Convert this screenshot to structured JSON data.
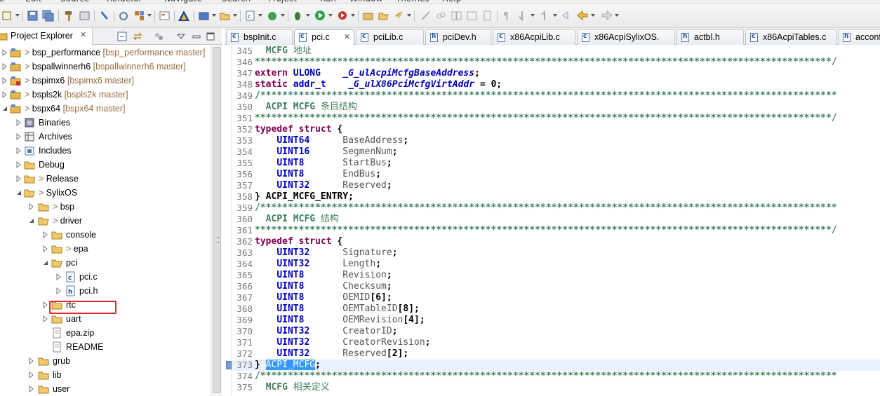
{
  "menu": {
    "items": [
      "File",
      "Edit",
      "Source",
      "Refactor",
      "Navigate",
      "Search",
      "Project",
      "Run",
      "Window",
      "Themes",
      "Help"
    ]
  },
  "explorer": {
    "title": "Project Explorer",
    "tree": [
      {
        "label": "bsp_performance",
        "repo": "[bsp_performance master]",
        "prefix": "> "
      },
      {
        "label": "bspallwinnerh6",
        "repo": "[bspallwinnerh6 master]",
        "prefix": "> "
      },
      {
        "label": "bspimx6",
        "repo": "[bspimx6 master]",
        "prefix": "> "
      },
      {
        "label": "bspls2k",
        "repo": "[bspls2k master]",
        "prefix": "> "
      },
      {
        "label": "bspx64",
        "repo": "[bspx64 master]",
        "prefix": "> "
      },
      {
        "label": "Binaries"
      },
      {
        "label": "Archives"
      },
      {
        "label": "Includes"
      },
      {
        "label": "Debug"
      },
      {
        "label": "Release",
        "prefix": "> "
      },
      {
        "label": "SylixOS",
        "prefix": "> "
      },
      {
        "label": "bsp",
        "prefix": "> "
      },
      {
        "label": "driver",
        "prefix": "> "
      },
      {
        "label": "console"
      },
      {
        "label": "epa",
        "prefix": "> "
      },
      {
        "label": "pci"
      },
      {
        "label": "pci.c"
      },
      {
        "label": "pci.h"
      },
      {
        "label": "rtc"
      },
      {
        "label": "uart"
      },
      {
        "label": "epa.zip"
      },
      {
        "label": "README"
      },
      {
        "label": "grub"
      },
      {
        "label": "lib"
      },
      {
        "label": "user"
      }
    ]
  },
  "editor": {
    "tabs": [
      {
        "label": "bspInit.c",
        "icon": "c"
      },
      {
        "label": "pci.c",
        "icon": "c",
        "active": true
      },
      {
        "label": "pciLib.c",
        "icon": "c"
      },
      {
        "label": "pciDev.h",
        "icon": "h"
      },
      {
        "label": "x86AcpiLib.c",
        "icon": "c"
      },
      {
        "label": "x86AcpiSylixOS.",
        "icon": "c"
      },
      {
        "label": "actbl.h",
        "icon": "h"
      },
      {
        "label": "x86AcpiTables.c",
        "icon": "c"
      },
      {
        "label": "acconf",
        "icon": "h"
      }
    ],
    "lines": [
      {
        "n": "345",
        "t": "  MCFG 地址"
      },
      {
        "n": "346",
        "t": "*********************************************************************************************************/"
      },
      {
        "n": "347",
        "t": "extern ULONG    _G_ulAcpiMcfgBaseAddress;"
      },
      {
        "n": "348",
        "t": "static addr_t    _G_ulX86PciMcfgVirtAddr = 0;"
      },
      {
        "n": "349",
        "t": "/*********************************************************************************************************"
      },
      {
        "n": "350",
        "t": "  ACPI MCFG 条目结构"
      },
      {
        "n": "351",
        "t": "*********************************************************************************************************/"
      },
      {
        "n": "352",
        "t": "typedef struct {"
      },
      {
        "n": "353",
        "t": "    UINT64      BaseAddress;"
      },
      {
        "n": "354",
        "t": "    UINT16      SegmenNum;"
      },
      {
        "n": "355",
        "t": "    UINT8       StartBus;"
      },
      {
        "n": "356",
        "t": "    UINT8       EndBus;"
      },
      {
        "n": "357",
        "t": "    UINT32      Reserved;"
      },
      {
        "n": "358",
        "t": "} ACPI_MCFG_ENTRY;"
      },
      {
        "n": "359",
        "t": "/*********************************************************************************************************"
      },
      {
        "n": "360",
        "t": "  ACPI MCFG 结构"
      },
      {
        "n": "361",
        "t": "*********************************************************************************************************/"
      },
      {
        "n": "362",
        "t": "typedef struct {"
      },
      {
        "n": "363",
        "t": "    UINT32      Signature;"
      },
      {
        "n": "364",
        "t": "    UINT32      Length;"
      },
      {
        "n": "365",
        "t": "    UINT8       Revision;"
      },
      {
        "n": "366",
        "t": "    UINT8       Checksum;"
      },
      {
        "n": "367",
        "t": "    UINT8       OEMID[6];"
      },
      {
        "n": "368",
        "t": "    UINT8       OEMTableID[8];"
      },
      {
        "n": "369",
        "t": "    UINT8       OEMRevision[4];"
      },
      {
        "n": "370",
        "t": "    UINT32      CreatorID;"
      },
      {
        "n": "371",
        "t": "    UINT32      CreatorRevision;"
      },
      {
        "n": "372",
        "t": "    UINT32      Reserved[2];"
      },
      {
        "n": "373",
        "t": "} ACPI_MCFG;"
      },
      {
        "n": "374",
        "t": "/*********************************************************************************************************"
      },
      {
        "n": "375",
        "t": "  MCFG 相关定义"
      }
    ],
    "selected_text": "ACPI_MCFG",
    "current_line": "373"
  },
  "colors": {
    "comment": "#3f7f5f",
    "keyword": "#7f0055",
    "type": "#0000c0",
    "selection": "#3399ff",
    "highlight_box": "#e2282d",
    "repo_label": "#936b3b"
  }
}
